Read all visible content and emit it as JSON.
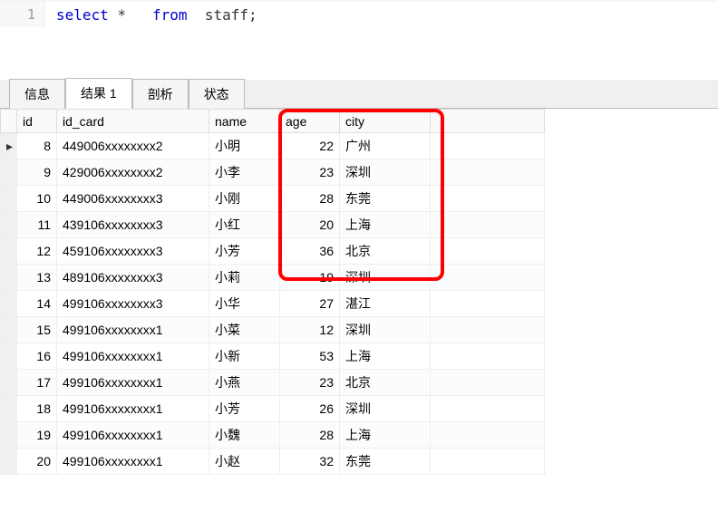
{
  "editor": {
    "line_number": "1",
    "sql_select": "select",
    "sql_star": "*",
    "sql_from": "from",
    "sql_table": "staff",
    "sql_semicolon": ";"
  },
  "tabs": {
    "info": "信息",
    "result": "结果 1",
    "profile": "剖析",
    "status": "状态"
  },
  "columns": {
    "id": "id",
    "id_card": "id_card",
    "name": "name",
    "age": "age",
    "city": "city"
  },
  "rows": [
    {
      "id": "8",
      "id_card": "449006xxxxxxxx2",
      "name": "小明",
      "age": "22",
      "city": "广州",
      "current": true
    },
    {
      "id": "9",
      "id_card": "429006xxxxxxxx2",
      "name": "小李",
      "age": "23",
      "city": "深圳",
      "current": false
    },
    {
      "id": "10",
      "id_card": "449006xxxxxxxx3",
      "name": "小刚",
      "age": "28",
      "city": "东莞",
      "current": false
    },
    {
      "id": "11",
      "id_card": "439106xxxxxxxx3",
      "name": "小红",
      "age": "20",
      "city": "上海",
      "current": false
    },
    {
      "id": "12",
      "id_card": "459106xxxxxxxx3",
      "name": "小芳",
      "age": "36",
      "city": "北京",
      "current": false
    },
    {
      "id": "13",
      "id_card": "489106xxxxxxxx3",
      "name": "小莉",
      "age": "19",
      "city": "深圳",
      "current": false
    },
    {
      "id": "14",
      "id_card": "499106xxxxxxxx3",
      "name": "小华",
      "age": "27",
      "city": "湛江",
      "current": false
    },
    {
      "id": "15",
      "id_card": "499106xxxxxxxx1",
      "name": "小菜",
      "age": "12",
      "city": "深圳",
      "current": false
    },
    {
      "id": "16",
      "id_card": "499106xxxxxxxx1",
      "name": "小新",
      "age": "53",
      "city": "上海",
      "current": false
    },
    {
      "id": "17",
      "id_card": "499106xxxxxxxx1",
      "name": "小燕",
      "age": "23",
      "city": "北京",
      "current": false
    },
    {
      "id": "18",
      "id_card": "499106xxxxxxxx1",
      "name": "小芳",
      "age": "26",
      "city": "深圳",
      "current": false
    },
    {
      "id": "19",
      "id_card": "499106xxxxxxxx1",
      "name": "小魏",
      "age": "28",
      "city": "上海",
      "current": false
    },
    {
      "id": "20",
      "id_card": "499106xxxxxxxx1",
      "name": "小赵",
      "age": "32",
      "city": "东莞",
      "current": false
    }
  ],
  "highlight": {
    "top": "0",
    "left": "307",
    "width": "183",
    "height": "190"
  }
}
